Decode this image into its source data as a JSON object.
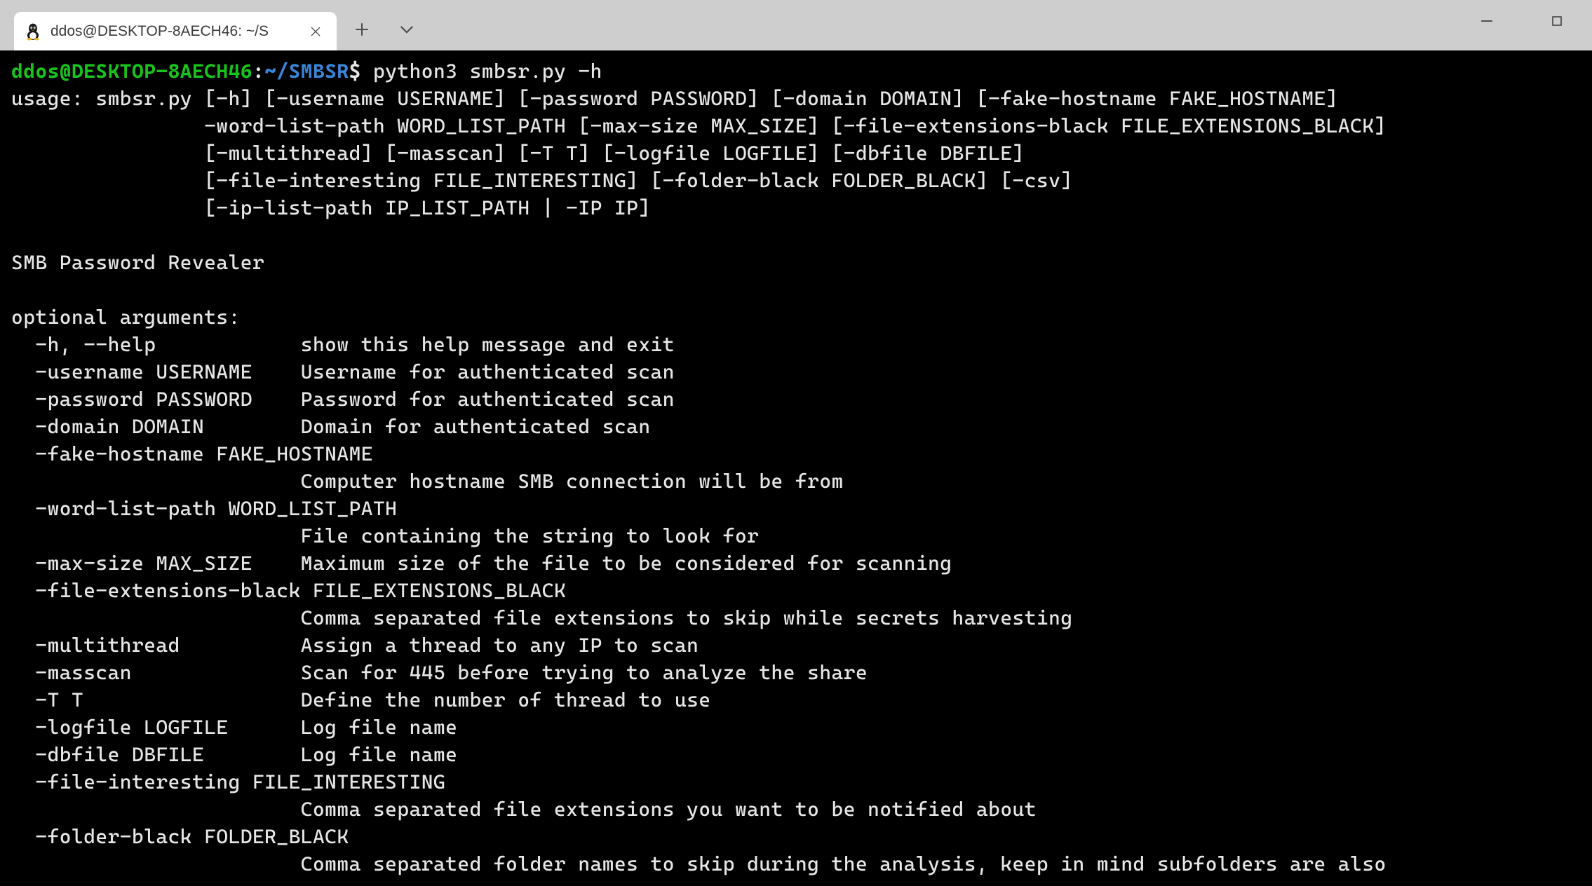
{
  "titlebar": {
    "tab_title": "ddos@DESKTOP-8AECH46: ~/S"
  },
  "prompt": {
    "user_host": "ddos@DESKTOP-8AECH46",
    "colon": ":",
    "tilde": "~",
    "slash": "/",
    "path": "SMBSR",
    "dollar": "$"
  },
  "command": "python3 smbsr.py -h",
  "output_lines": [
    "usage: smbsr.py [-h] [-username USERNAME] [-password PASSWORD] [-domain DOMAIN] [-fake-hostname FAKE_HOSTNAME]",
    "                -word-list-path WORD_LIST_PATH [-max-size MAX_SIZE] [-file-extensions-black FILE_EXTENSIONS_BLACK]",
    "                [-multithread] [-masscan] [-T T] [-logfile LOGFILE] [-dbfile DBFILE]",
    "                [-file-interesting FILE_INTERESTING] [-folder-black FOLDER_BLACK] [-csv]",
    "                [-ip-list-path IP_LIST_PATH | -IP IP]",
    "",
    "SMB Password Revealer",
    "",
    "optional arguments:",
    "  -h, --help            show this help message and exit",
    "  -username USERNAME    Username for authenticated scan",
    "  -password PASSWORD    Password for authenticated scan",
    "  -domain DOMAIN        Domain for authenticated scan",
    "  -fake-hostname FAKE_HOSTNAME",
    "                        Computer hostname SMB connection will be from",
    "  -word-list-path WORD_LIST_PATH",
    "                        File containing the string to look for",
    "  -max-size MAX_SIZE    Maximum size of the file to be considered for scanning",
    "  -file-extensions-black FILE_EXTENSIONS_BLACK",
    "                        Comma separated file extensions to skip while secrets harvesting",
    "  -multithread          Assign a thread to any IP to scan",
    "  -masscan              Scan for 445 before trying to analyze the share",
    "  -T T                  Define the number of thread to use",
    "  -logfile LOGFILE      Log file name",
    "  -dbfile DBFILE        Log file name",
    "  -file-interesting FILE_INTERESTING",
    "                        Comma separated file extensions you want to be notified about",
    "  -folder-black FOLDER_BLACK",
    "                        Comma separated folder names to skip during the analysis, keep in mind subfolders are also"
  ]
}
